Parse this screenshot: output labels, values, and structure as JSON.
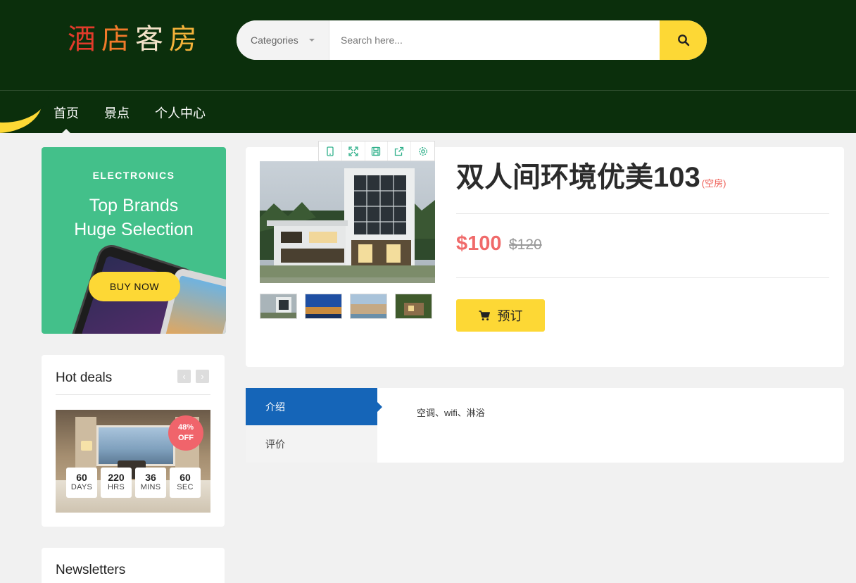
{
  "header": {
    "logo_chars": [
      "酒",
      "店",
      "客",
      "房"
    ],
    "categories_label": "Categories",
    "search_placeholder": "Search here..."
  },
  "nav": {
    "items": [
      {
        "label": "首页",
        "active": true
      },
      {
        "label": "景点",
        "active": false
      },
      {
        "label": "个人中心",
        "active": false
      }
    ]
  },
  "promo": {
    "eyebrow": "ELECTRONICS",
    "title_line1": "Top Brands",
    "title_line2": "Huge Selection",
    "button": "BUY NOW"
  },
  "hot_deals": {
    "title": "Hot deals",
    "discount_line1": "48%",
    "discount_line2": "OFF",
    "timer": [
      {
        "value": "60",
        "unit": "DAYS"
      },
      {
        "value": "220",
        "unit": "HRS"
      },
      {
        "value": "36",
        "unit": "MINS"
      },
      {
        "value": "60",
        "unit": "SEC"
      }
    ]
  },
  "newsletters": {
    "title": "Newsletters"
  },
  "product": {
    "title": "双人间环境优美103",
    "availability": "(空房)",
    "price_new": "$100",
    "price_old": "$120",
    "book_label": "预订",
    "toolbar_icons": [
      "phone-icon",
      "fullscreen-icon",
      "save-icon",
      "share-icon",
      "settings-icon"
    ]
  },
  "tabs": {
    "items": [
      {
        "label": "介绍",
        "active": true
      },
      {
        "label": "评价",
        "active": false
      }
    ],
    "content": "空调、wifi、淋浴"
  },
  "colors": {
    "header_bg": "#0b2f0c",
    "accent_yellow": "#fdd835",
    "promo_green": "#43c08a",
    "price_red": "#f06a6a",
    "tab_blue": "#1565b8"
  }
}
